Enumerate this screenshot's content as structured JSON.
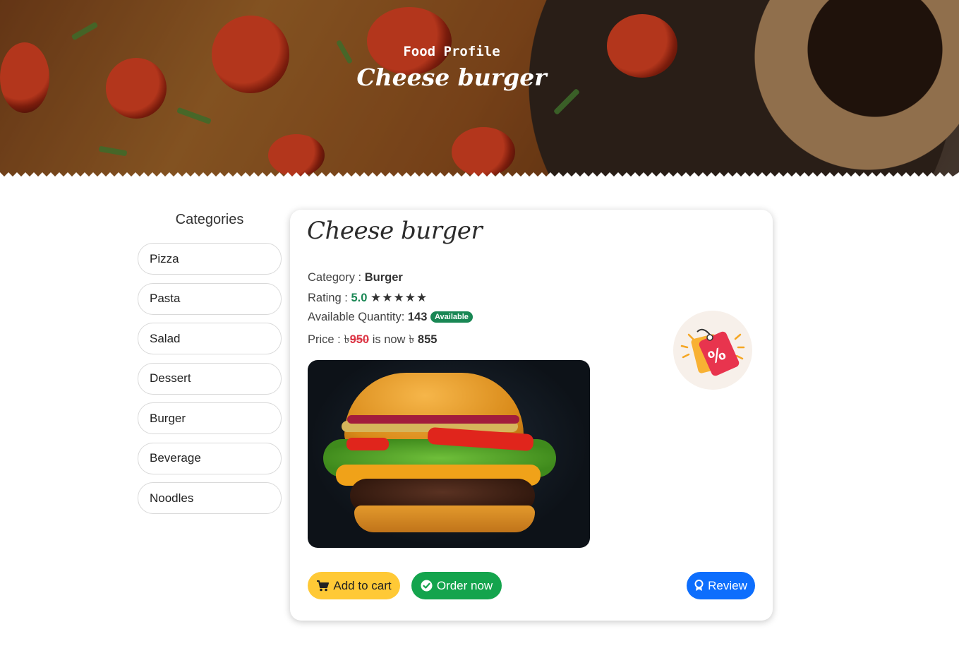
{
  "hero": {
    "subtitle": "Food Profile",
    "title": "Cheese burger"
  },
  "sidebar": {
    "title": "Categories",
    "items": [
      {
        "label": "Pizza"
      },
      {
        "label": "Pasta"
      },
      {
        "label": "Salad"
      },
      {
        "label": "Dessert"
      },
      {
        "label": "Burger"
      },
      {
        "label": "Beverage"
      },
      {
        "label": "Noodles"
      }
    ]
  },
  "product": {
    "name": "Cheese burger",
    "category_label": "Category :",
    "category": "Burger",
    "rating_label": "Rating :",
    "rating": "5.0",
    "stars": "★★★★★",
    "quantity_label": "Available Quantity:",
    "quantity": "143",
    "availability_badge": "Available",
    "price_label": "Price :",
    "currency": "৳",
    "old_price": "950",
    "price_joiner": "is now",
    "new_price": "855",
    "image_icon": "burger-image",
    "promo_icon": "discount-tag-icon"
  },
  "actions": {
    "add_to_cart": "Add to cart",
    "order_now": "Order now",
    "review": "Review"
  },
  "colors": {
    "accent_yellow": "#ffc936",
    "accent_green": "#14a44d",
    "accent_blue": "#0d6efd",
    "old_price_red": "#dc3545"
  }
}
